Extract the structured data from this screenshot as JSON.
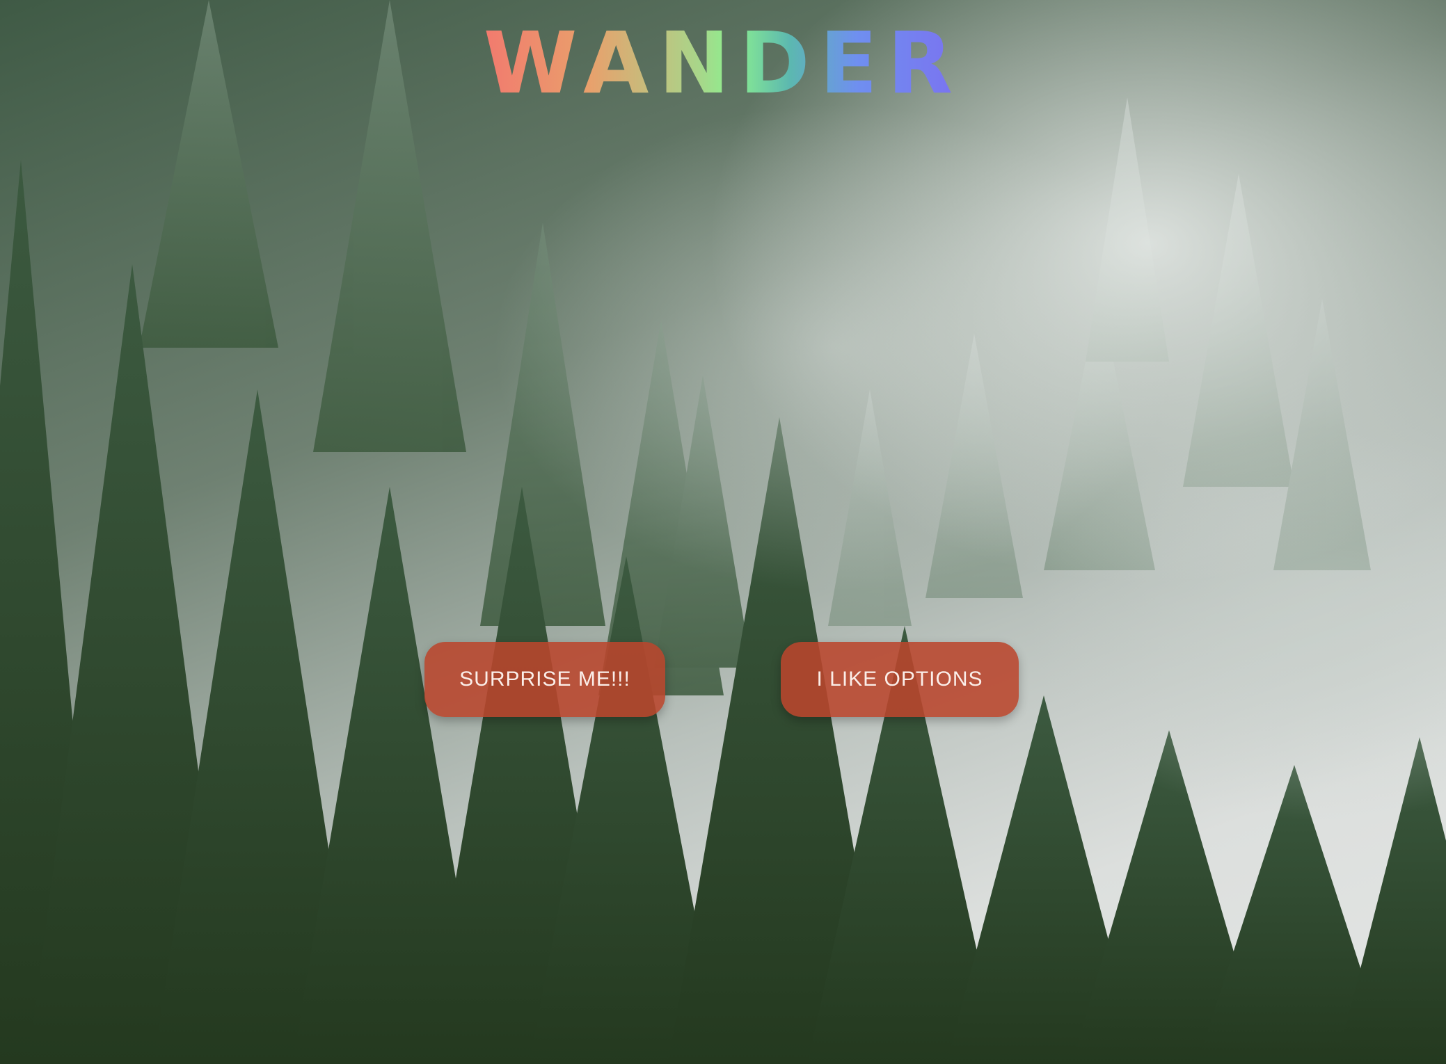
{
  "header": {
    "logo_text": "WANDER"
  },
  "actions": {
    "surprise_label": "SURPRISE ME!!!",
    "options_label": "I LIKE OPTIONS"
  },
  "colors": {
    "button_background": "#BA462C",
    "button_text": "#FBEEE9",
    "logo_gradient": [
      "#F27A6E",
      "#E9A06C",
      "#8CF08F",
      "#6F8FF0",
      "#7B72F0"
    ]
  },
  "background": {
    "description_icon": "misty-pine-forest-image"
  }
}
